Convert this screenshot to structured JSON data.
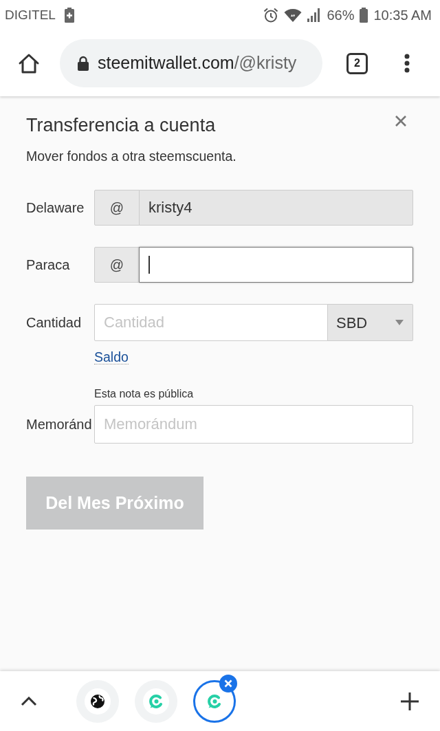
{
  "status_bar": {
    "carrier": "DIGITEL",
    "battery_percent": "66%",
    "time": "10:35 AM"
  },
  "browser_toolbar": {
    "url_host": "steemitwallet.com",
    "url_path": "/@kristy",
    "tab_count": "2"
  },
  "dialog": {
    "title": "Transferencia a cuenta",
    "subtitle": "Mover fondos a otra steemscuenta.",
    "fields": [
      {
        "kind": "account",
        "label": "Delaware",
        "prefix": "@",
        "value": "kristy4",
        "disabled": true,
        "focused": false
      },
      {
        "kind": "account",
        "label": "Paraca",
        "prefix": "@",
        "disabled": false,
        "focused": true
      },
      {
        "kind": "amount",
        "label": "Cantidad",
        "placeholder": "Cantidad",
        "currency": "SBD",
        "link": "Saldo",
        "disabled": false,
        "focused": false
      },
      {
        "kind": "memo",
        "label": "Memoránd",
        "note": "Esta nota es pública",
        "placeholder": "Memorándum",
        "disabled": false,
        "focused": false
      }
    ],
    "submit": {
      "label": "Del Mes Próximo",
      "disabled": true
    }
  },
  "tab_strip": {
    "tabs": [
      {
        "kind": "globe",
        "selected": false
      },
      {
        "kind": "swirl",
        "selected": false
      },
      {
        "kind": "swirl",
        "selected": true
      }
    ]
  }
}
